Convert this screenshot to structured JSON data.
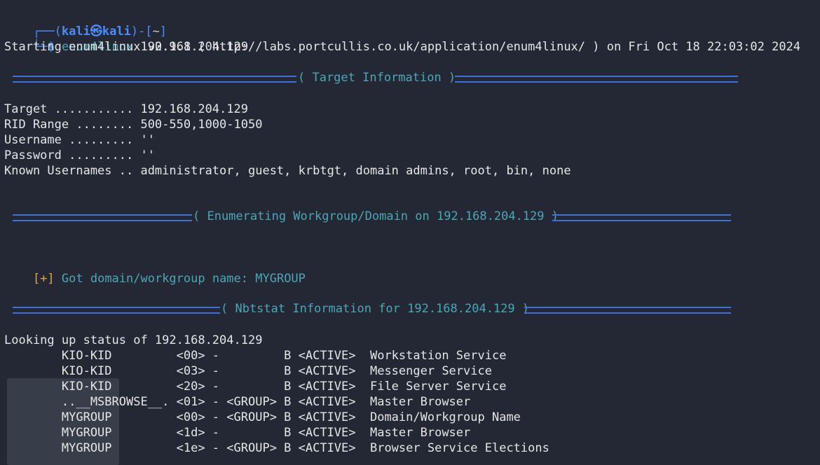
{
  "prompt": {
    "corner_top": "┌──",
    "corner_bottom": "└─",
    "open_paren": "(",
    "user": "kali",
    "at_symbol": "㉿",
    "host": "kali",
    "close_paren": ")-[",
    "dir": "~",
    "close_bracket": "]",
    "dollar": "$",
    "command": "enum4linux",
    "argument": "192.168.204.129"
  },
  "output": {
    "starting_line": "Starting enum4linux v0.9.1 ( http://labs.portcullis.co.uk/application/enum4linux/ ) on Fri Oct 18 22:03:02 2024",
    "section1_title": "( Target Information )",
    "target_info": [
      "Target ........... 192.168.204.129",
      "RID Range ........ 500-550,1000-1050",
      "Username ......... ''",
      "Password ......... ''",
      "Known Usernames .. administrator, guest, krbtgt, domain admins, root, bin, none"
    ],
    "section2_title": "( Enumerating Workgroup/Domain on 192.168.204.129 )",
    "got_prefix": "[+]",
    "got_text": " Got domain/workgroup name: MYGROUP",
    "section3_title": "( Nbtstat Information for 192.168.204.129 )",
    "lookup_line": "Looking up status of 192.168.204.129",
    "nbt_rows": [
      "        KIO-KID         <00> -         B <ACTIVE>  Workstation Service",
      "        KIO-KID         <03> -         B <ACTIVE>  Messenger Service",
      "        KIO-KID         <20> -         B <ACTIVE>  File Server Service",
      "        ..__MSBROWSE__. <01> - <GROUP> B <ACTIVE>  Master Browser",
      "        MYGROUP         <00> - <GROUP> B <ACTIVE>  Domain/Workgroup Name",
      "        MYGROUP         <1d> -         B <ACTIVE>  Master Browser",
      "        MYGROUP         <1e> - <GROUP> B <ACTIVE>  Browser Service Elections"
    ]
  },
  "colors": {
    "background": "#232834",
    "prompt_blue": "#4c8cff",
    "section_cyan": "#4aa7b8",
    "rule_blue": "#3f6fd8",
    "plus_orange": "#e7a33e",
    "text": "#e6e6e6"
  }
}
